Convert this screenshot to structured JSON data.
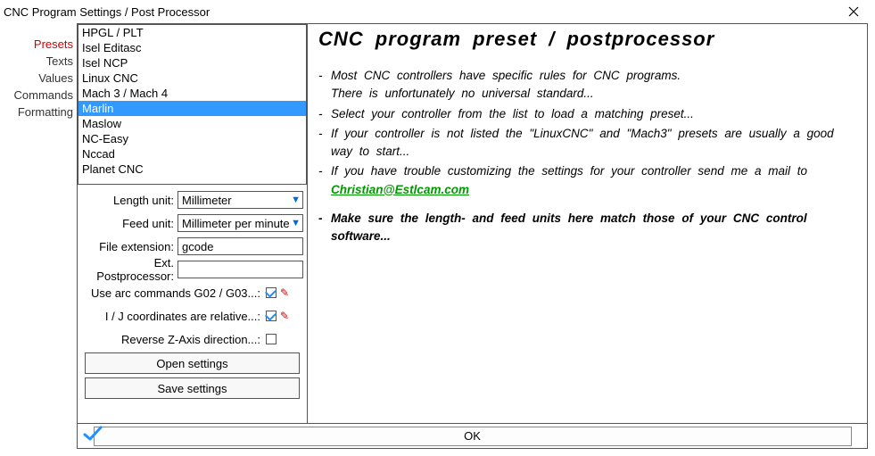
{
  "window": {
    "title": "CNC Program Settings / Post Processor"
  },
  "tabs": [
    {
      "label": "Presets",
      "active": true
    },
    {
      "label": "Texts",
      "active": false
    },
    {
      "label": "Values",
      "active": false
    },
    {
      "label": "Commands",
      "active": false
    },
    {
      "label": "Formatting",
      "active": false
    }
  ],
  "presets": {
    "items": [
      "HPGL / PLT",
      "Isel Editasc",
      "Isel NCP",
      "Linux CNC",
      "Mach 3 / Mach 4",
      "Marlin",
      "Maslow",
      "NC-Easy",
      "Nccad",
      "Planet CNC"
    ],
    "selected_index": 5
  },
  "form": {
    "length_unit_label": "Length unit:",
    "length_unit_value": "Millimeter",
    "feed_unit_label": "Feed unit:",
    "feed_unit_value": "Millimeter per minute",
    "file_ext_label": "File extension:",
    "file_ext_value": "gcode",
    "ext_pp_label": "Ext. Postprocessor:",
    "ext_pp_value": "",
    "use_arc_label": "Use arc commands G02 / G03...:",
    "use_arc_checked": true,
    "ij_rel_label": "I / J coordinates are relative...:",
    "ij_rel_checked": true,
    "rev_z_label": "Reverse Z-Axis direction...:",
    "rev_z_checked": false
  },
  "buttons": {
    "open_settings": "Open settings",
    "save_settings": "Save settings",
    "ok": "OK"
  },
  "help": {
    "title": "CNC program preset / postprocessor",
    "lines": {
      "l1a": "Most CNC controllers have specific rules for CNC programs.",
      "l1b": "There is unfortunately  no universal standard...",
      "l2": "Select your controller from the list to load a matching  preset...",
      "l3": "If your controller is not listed the \"LinuxCNC\"  and \"Mach3\"  presets are usually a good way to start...",
      "l4a": "If you have trouble customizing  the settings  for your controller send me a mail to",
      "email": "Christian@Estlcam.com",
      "l5": "Make sure the length-  and feed units here match  those of your CNC control software..."
    }
  }
}
